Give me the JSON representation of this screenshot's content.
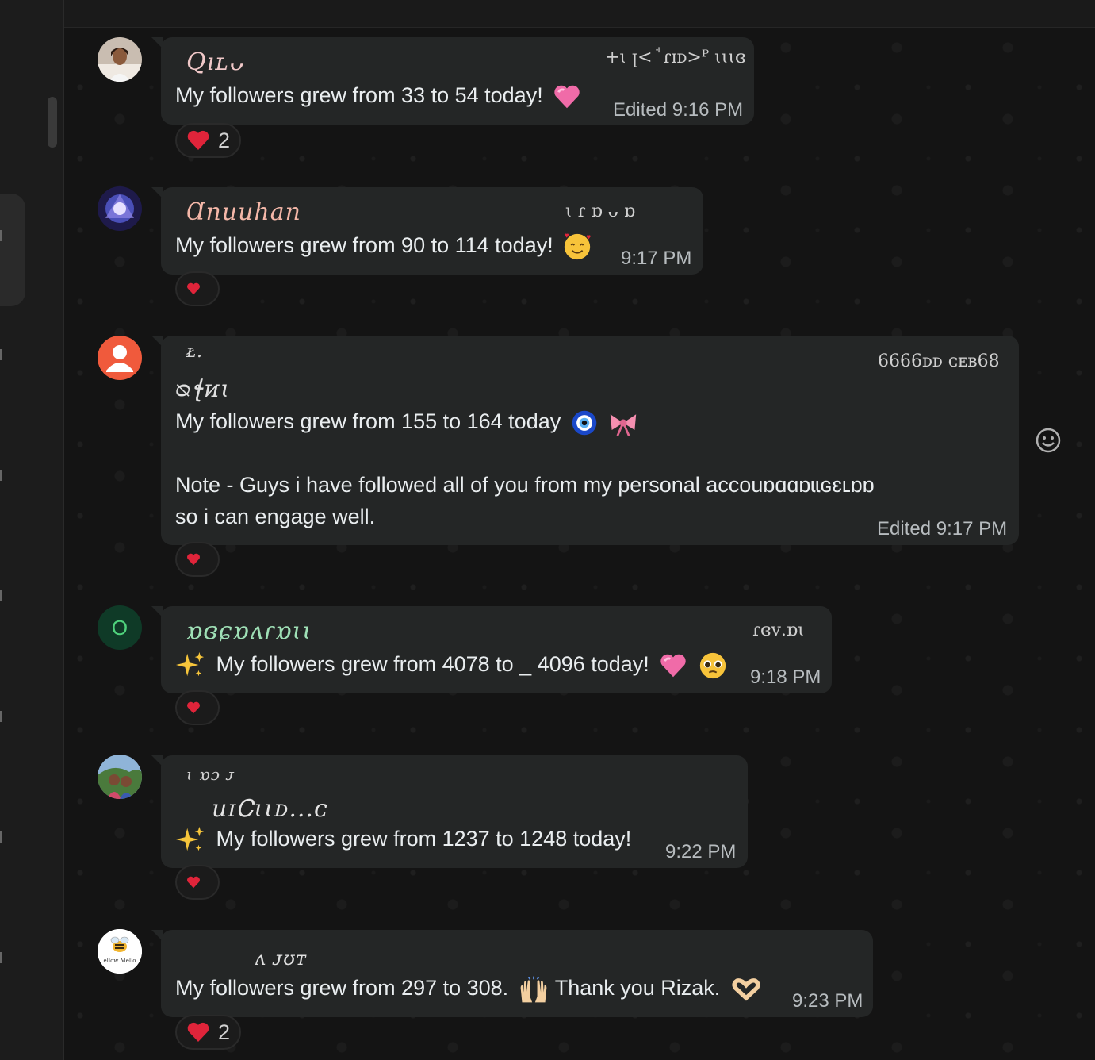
{
  "messages": [
    {
      "sender": "Qıʟᴗ",
      "sender_meta": "+ɩ ꞁ< ꜗ ɾɪᴅ>ᴾ ɩɩɩɞ",
      "text": "My followers grew from 33 to 54 today!",
      "emojis": [
        "pink-heart"
      ],
      "time": "Edited 9:16 PM",
      "reaction": {
        "emoji": "red-heart",
        "count": "2"
      }
    },
    {
      "sender": "Ɑnuuhan",
      "sender_meta": "ɩ ɾ ɒ ᴗ ɒ",
      "text": "My followers grew from 90 to 114 today!",
      "emojis": [
        "smiling-face-with-hearts"
      ],
      "time": "9:17 PM",
      "reaction": {
        "emoji": "red-heart",
        "count": ""
      }
    },
    {
      "sender": "ᴌ.",
      "sender_line2": "ᴓꞎᴎɩ",
      "sender_meta": "6666ᴅᴅ ᴄᴇʙ68",
      "lines": [
        "My followers grew from 155 to 164 today",
        "",
        "Note - Guys i have followed all of you from my personal accouɒɑɑɒɩɩɢɛʟɒɒ ",
        "so i can engage well."
      ],
      "emojis": [
        "nazar-amulet",
        "pink-bow"
      ],
      "time": "Edited 9:17 PM",
      "reaction": {
        "emoji": "red-heart",
        "count": ""
      }
    },
    {
      "avatar_letter": "O",
      "sender": "ɒɞɕɒʌɾɒɩɩ",
      "sender_meta": "ɾɞᴠ.ɒɩ",
      "text": "My followers grew from 4078 to _ 4096 today!",
      "lead_emoji": "sparkles",
      "emojis": [
        "pink-heart",
        "pleading-face"
      ],
      "time": "9:18 PM",
      "reaction": {
        "emoji": "red-heart",
        "count": ""
      }
    },
    {
      "sender": "ɩ ɒɔ ᴊ",
      "sender_line2": "uɪᏟɩɩᴅ...ᴄ",
      "text": "My followers grew from 1237 to 1248 today!",
      "lead_emoji": "sparkles",
      "emojis": [],
      "time": "9:22 PM",
      "reaction": {
        "emoji": "red-heart",
        "count": ""
      }
    },
    {
      "avatar_text": "ellow Mello",
      "sender": "ʌ ᴊʊᴛ",
      "text": "My followers grew from 297 to 308.",
      "text2": "Thank you Rizak.",
      "emojis": [
        "raising-hands",
        "heart-hands"
      ],
      "time": "9:23 PM",
      "reaction": {
        "emoji": "red-heart",
        "count": "2"
      }
    }
  ],
  "colors": {
    "bubble": "#242626",
    "background": "#141414",
    "time": "#b7bcbf",
    "reaction_heart": "#e0243a"
  },
  "icons": {
    "emoji_picker": "smiley-icon"
  }
}
